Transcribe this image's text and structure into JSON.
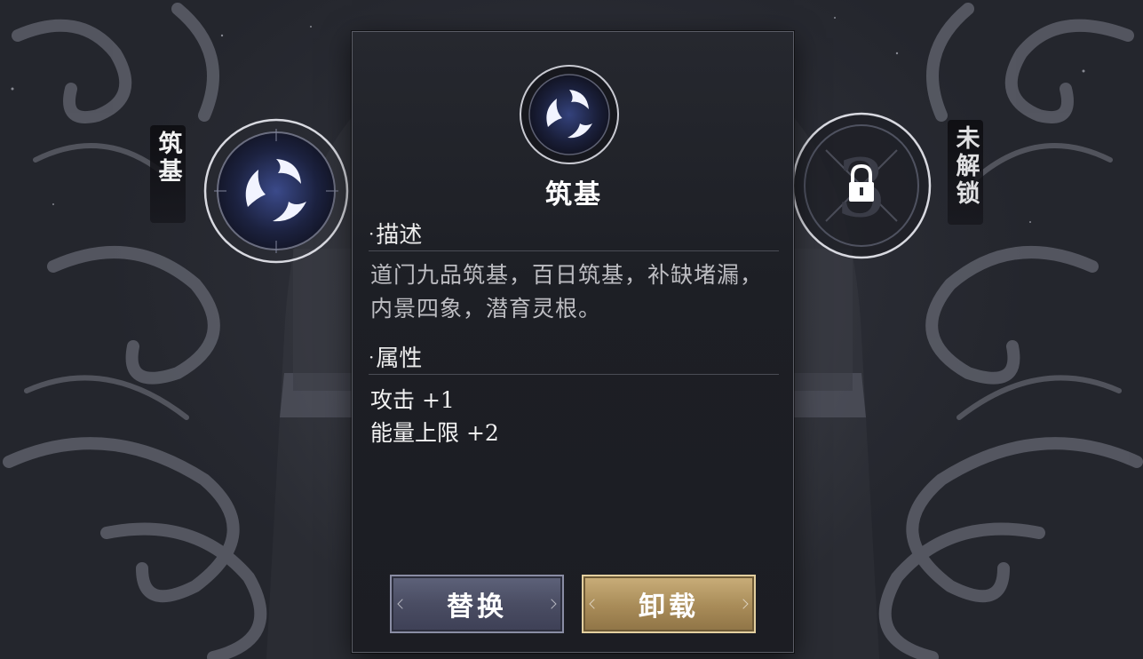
{
  "left_slot": {
    "label": "筑基",
    "icon": "swirl-realm-icon"
  },
  "right_slot": {
    "label": "未解锁",
    "icon": "lock-icon",
    "faded_number": "3"
  },
  "panel": {
    "title": "筑基",
    "icon": "swirl-realm-icon",
    "description": {
      "heading": "描述",
      "text": "道门九品筑基，百日筑基，补缺堵漏，内景四象，潜育灵根。"
    },
    "attributes": {
      "heading": "属性",
      "items": [
        "攻击 +1",
        "能量上限 +2"
      ]
    },
    "buttons": {
      "replace_label": "替换",
      "unload_label": "卸载"
    }
  },
  "colors": {
    "panel_bg": "#1d1f25",
    "replace_button": "#4a4d63",
    "unload_button": "#a88b58",
    "emblem_glow": "#aab8ff"
  }
}
